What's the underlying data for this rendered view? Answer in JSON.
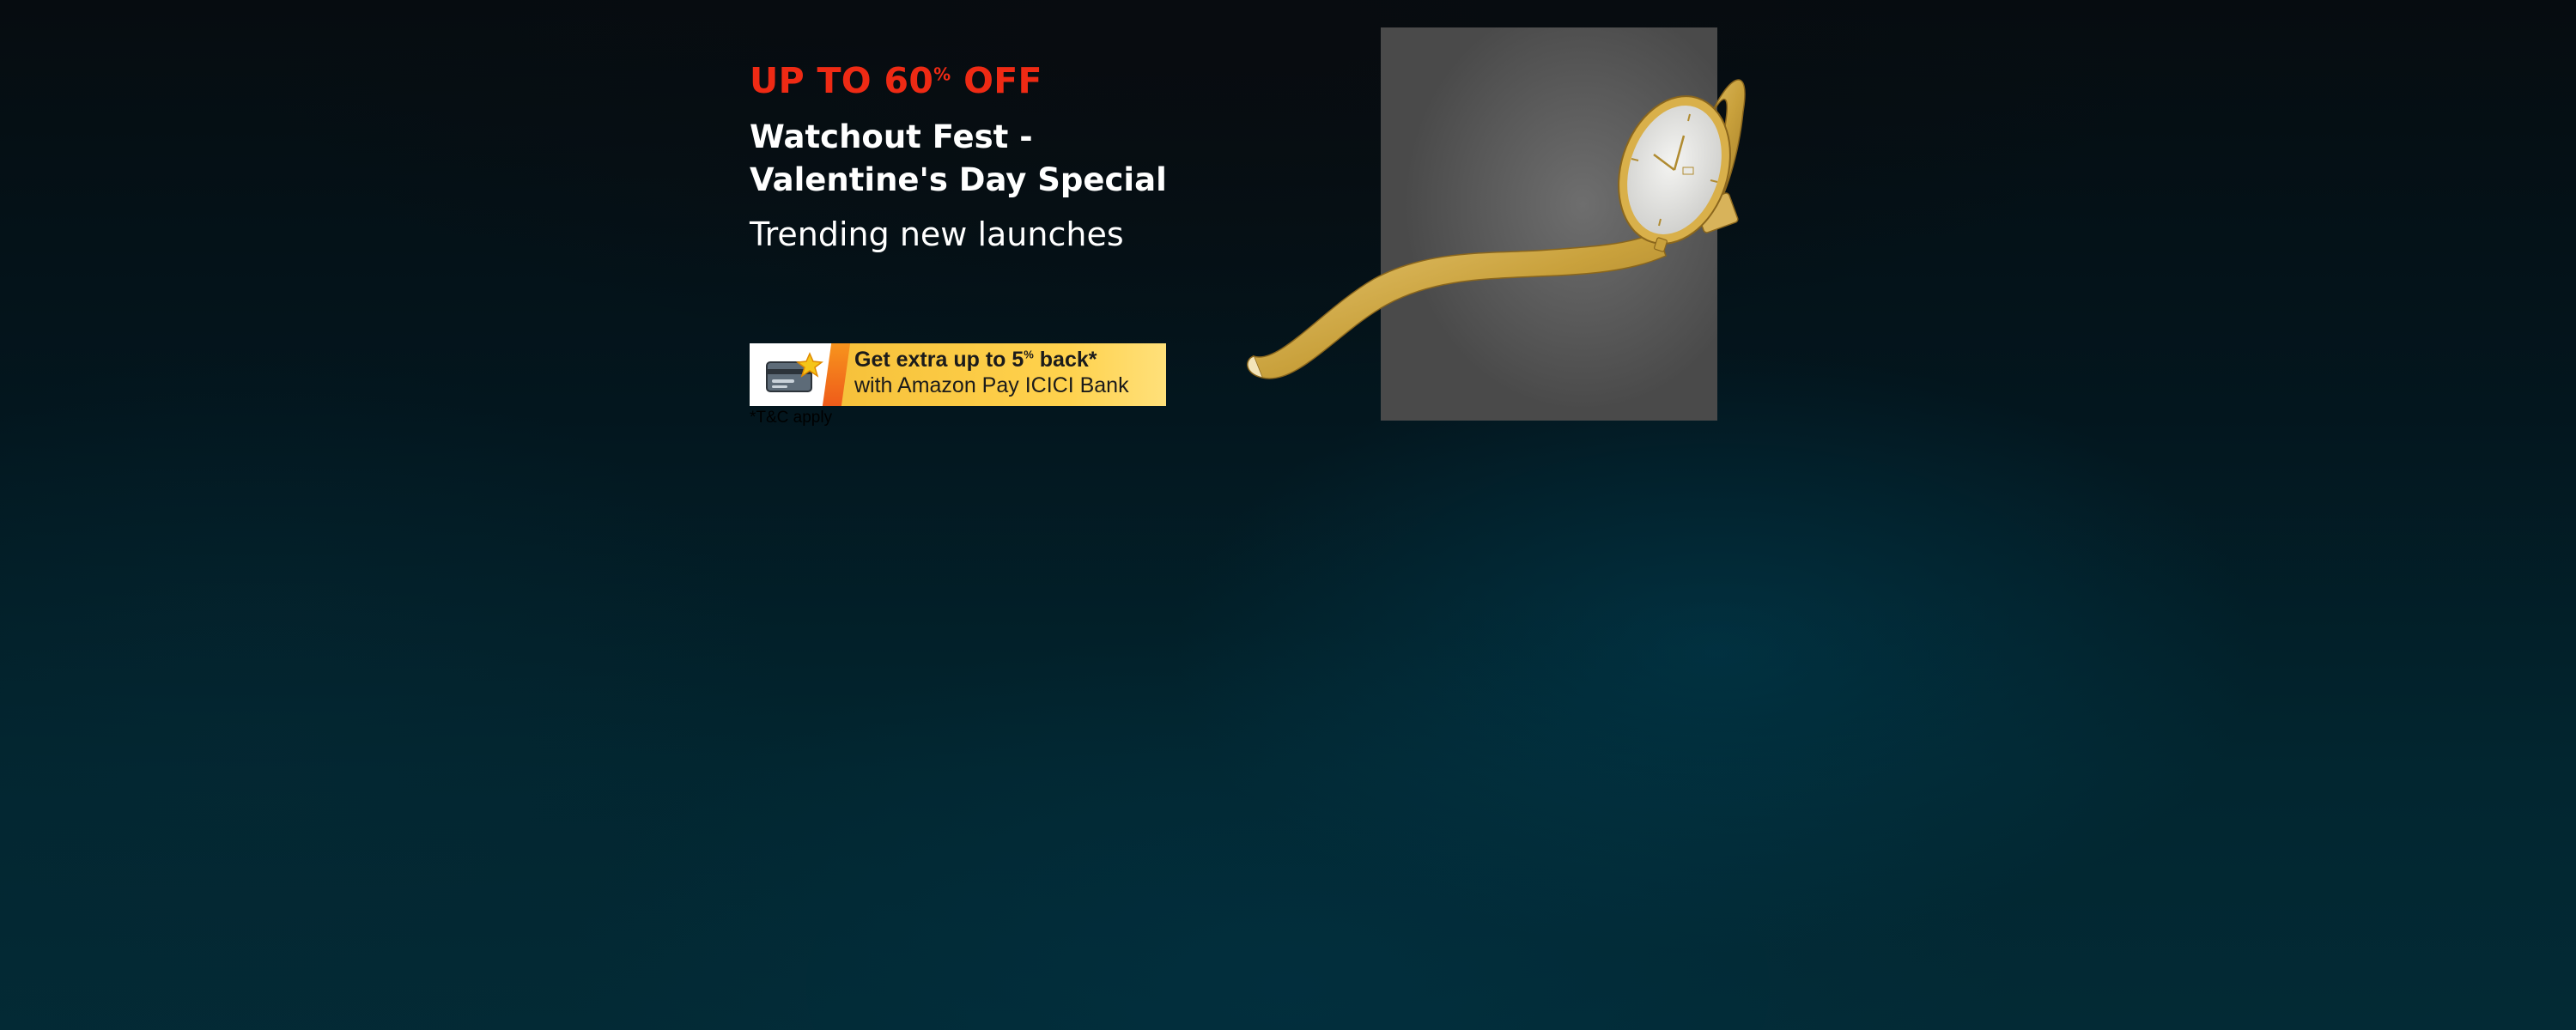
{
  "promo": {
    "discount_prefix": "UP TO 60",
    "discount_percent_sign": "%",
    "discount_suffix": " OFF",
    "event_title_line1": "Watchout Fest -",
    "event_title_line2": "Valentine's Day Special",
    "tagline": "Trending new launches"
  },
  "bank_offer": {
    "line1_prefix": "Get extra up to 5",
    "line1_percent_sign": "%",
    "line1_suffix": " back*",
    "line2": "with Amazon Pay ICICI Bank",
    "terms": "*T&C apply"
  },
  "product": {
    "icon": "gold-mesh-watch-image"
  },
  "colors": {
    "discount": "#ee2a14",
    "text": "#ffffff",
    "offer_yellow": "#ffd24d",
    "offer_orange": "#f7941d",
    "watch_gold": "#c9a13c"
  }
}
